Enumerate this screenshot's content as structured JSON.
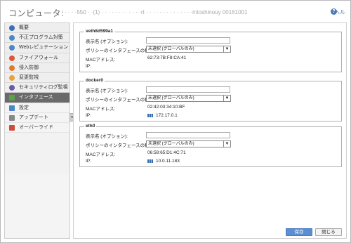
{
  "header": {
    "title_label": "コンピュータ:",
    "title_name": "· · · ·550 · ·(1) · · · · · · · ·  · · · ·rt · · · ·  · · · ·  · · · ·  · ·intoshinouy 00161001",
    "help_text": "ヘル"
  },
  "sidebar": {
    "items": [
      {
        "label": "概要",
        "icon": "check-icon",
        "color": "#3d6fb5"
      },
      {
        "label": "不正プログラム対策",
        "icon": "shield-icon",
        "color": "#4a86c8"
      },
      {
        "label": "Webレピュテーション",
        "icon": "globe-icon",
        "color": "#4a86c8"
      },
      {
        "label": "ファイアウォール",
        "icon": "firewall-icon",
        "color": "#e0553b"
      },
      {
        "label": "侵入防御",
        "icon": "ips-icon",
        "color": "#e07a2b"
      },
      {
        "label": "変更監視",
        "icon": "integrity-icon",
        "color": "#e8a23a"
      },
      {
        "label": "セキュリティログ監視",
        "icon": "log-icon",
        "color": "#6c5aa8"
      },
      {
        "label": "インタフェース",
        "icon": "interface-icon",
        "color": "#5aa24a"
      },
      {
        "label": "設定",
        "icon": "settings-icon",
        "color": "#4a86c8"
      },
      {
        "label": "アップデート",
        "icon": "update-icon",
        "color": "#888888"
      },
      {
        "label": "オーバーライド",
        "icon": "override-icon",
        "color": "#d04a3a"
      }
    ]
  },
  "interfaces": [
    {
      "name": "veth8d599a1",
      "display_name_label": "表示名 (オプション):",
      "policy_label": "ポリシーのインタフェースの種類:",
      "policy_value": "未選択 (グローバルのみ)",
      "mac_label": "MACアドレス:",
      "mac_value": "62:73:7B:F8:CA:41",
      "ip_label": "IP:",
      "ip_value": ""
    },
    {
      "name": "docker0",
      "display_name_label": "表示名 (オプション):",
      "policy_label": "ポリシーのインタフェースの種類:",
      "policy_value": "未選択 (グローバルのみ)",
      "mac_label": "MACアドレス:",
      "mac_value": "02:42:03:34:10:BF",
      "ip_label": "IP:",
      "ip_value": "172.17.0.1"
    },
    {
      "name": "eth0",
      "display_name_label": "表示名 (オプション):",
      "policy_label": "ポリシーのインタフェースの種類:",
      "policy_value": "未選択 (グローバルのみ)",
      "mac_label": "MACアドレス:",
      "mac_value": "06:58:65:D1:4C:71",
      "ip_label": "IP:",
      "ip_value": "10.0.11.183"
    }
  ],
  "footer": {
    "save_label": "保存",
    "close_label": "閉じる"
  },
  "colors": {
    "accent": "#5b8fd4",
    "sidebar_active": "#6a6a6a"
  }
}
